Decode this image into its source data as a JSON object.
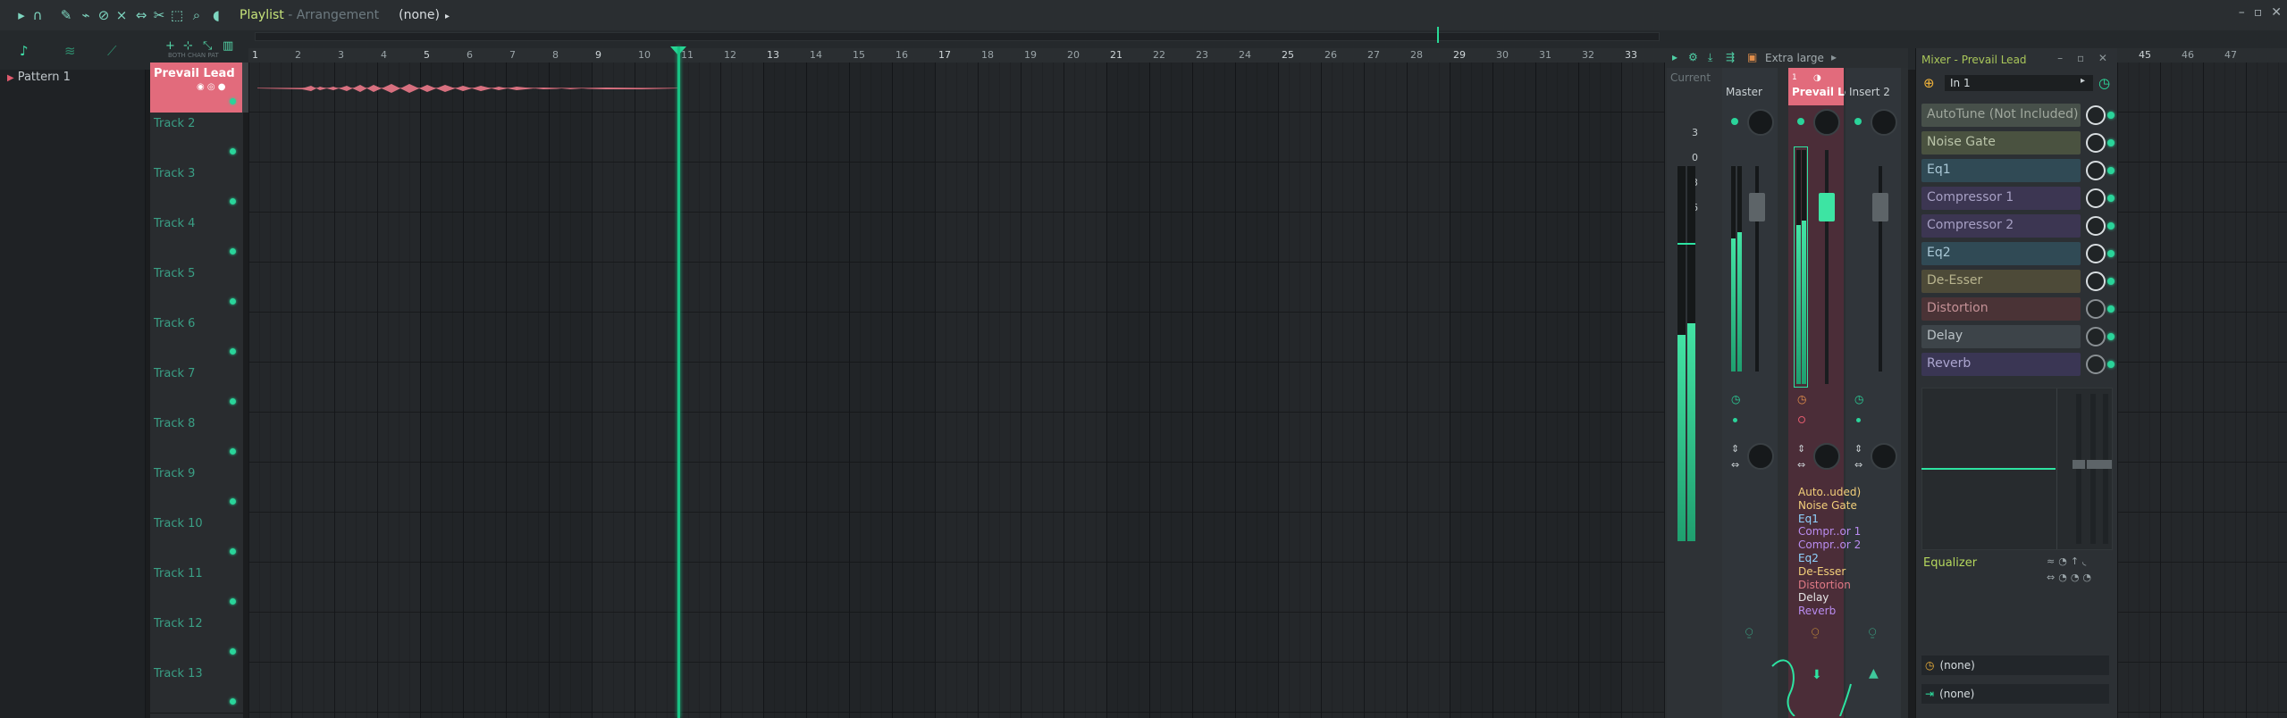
{
  "window": {
    "title_app": "Playlist",
    "title_sep": " - ",
    "title_mode": "Arrangement",
    "pattern_selector": "(none)"
  },
  "browser": {
    "pattern": "Pattern 1"
  },
  "playlist": {
    "ruler_numbers": [
      "1",
      "2",
      "3",
      "4",
      "5",
      "6",
      "7",
      "8",
      "9",
      "10",
      "11",
      "12",
      "13",
      "14",
      "15",
      "16",
      "17",
      "18",
      "19",
      "20",
      "21",
      "22",
      "23",
      "24",
      "25",
      "26",
      "27",
      "28",
      "29",
      "30",
      "31",
      "32",
      "33"
    ],
    "right_ruler_numbers": [
      "45",
      "46",
      "47"
    ],
    "tracks": [
      {
        "label": "Prevail Lead"
      },
      {
        "label": "Track 2"
      },
      {
        "label": "Track 3"
      },
      {
        "label": "Track 4"
      },
      {
        "label": "Track 5"
      },
      {
        "label": "Track 6"
      },
      {
        "label": "Track 7"
      },
      {
        "label": "Track 8"
      },
      {
        "label": "Track 9"
      },
      {
        "label": "Track 10"
      },
      {
        "label": "Track 11"
      },
      {
        "label": "Track 12"
      },
      {
        "label": "Track 13"
      }
    ],
    "header_labels": "BOTH   CHAN   PAT"
  },
  "mixer": {
    "size_label": "Extra large",
    "strips": [
      {
        "num": "",
        "name": "Current"
      },
      {
        "num": "",
        "name": "Master"
      },
      {
        "num": "1",
        "name": "Prevail Lead"
      },
      {
        "num": "",
        "name": "Insert 2"
      }
    ],
    "meter_scale": [
      "3",
      "0",
      "3",
      "6"
    ],
    "fx_short": [
      {
        "label": "Auto..uded)",
        "color": "#f2cf7a"
      },
      {
        "label": "Noise Gate",
        "color": "#f2cf7a"
      },
      {
        "label": "Eq1",
        "color": "#8fd3ff"
      },
      {
        "label": "Compr..or 1",
        "color": "#b98cf0"
      },
      {
        "label": "Compr..or 2",
        "color": "#b98cf0"
      },
      {
        "label": "Eq2",
        "color": "#8fd3ff"
      },
      {
        "label": "De-Esser",
        "color": "#f2cf7a"
      },
      {
        "label": "Distortion",
        "color": "#e07a86"
      },
      {
        "label": "Delay",
        "color": "#e6e6e6"
      },
      {
        "label": "Reverb",
        "color": "#b98cf0"
      }
    ]
  },
  "insert_panel": {
    "title": "Mixer - Prevail Lead",
    "input": "In 1",
    "slots": [
      {
        "label": "AutoTune (Not Included)",
        "bg": "#47504a",
        "fg": "#9fa79d"
      },
      {
        "label": "Noise Gate",
        "bg": "#4a5240",
        "fg": "#b9c3a8"
      },
      {
        "label": "Eq1",
        "bg": "#304a55",
        "fg": "#a9c8d6"
      },
      {
        "label": "Compressor 1",
        "bg": "#3c3652",
        "fg": "#a7a0c4"
      },
      {
        "label": "Compressor 2",
        "bg": "#3c3652",
        "fg": "#a7a0c4"
      },
      {
        "label": "Eq2",
        "bg": "#304a55",
        "fg": "#a9c8d6"
      },
      {
        "label": "De-Esser",
        "bg": "#4d4a38",
        "fg": "#b8b48e"
      },
      {
        "label": "Distortion",
        "bg": "#4a3336",
        "fg": "#c49196"
      },
      {
        "label": "Delay",
        "bg": "#3d4449",
        "fg": "#b9c1c5"
      },
      {
        "label": "Reverb",
        "bg": "#3a3654",
        "fg": "#aca6d0"
      }
    ],
    "eq_label": "Equalizer",
    "send_bottom_1": "(none)",
    "send_bottom_2": "(none)"
  }
}
